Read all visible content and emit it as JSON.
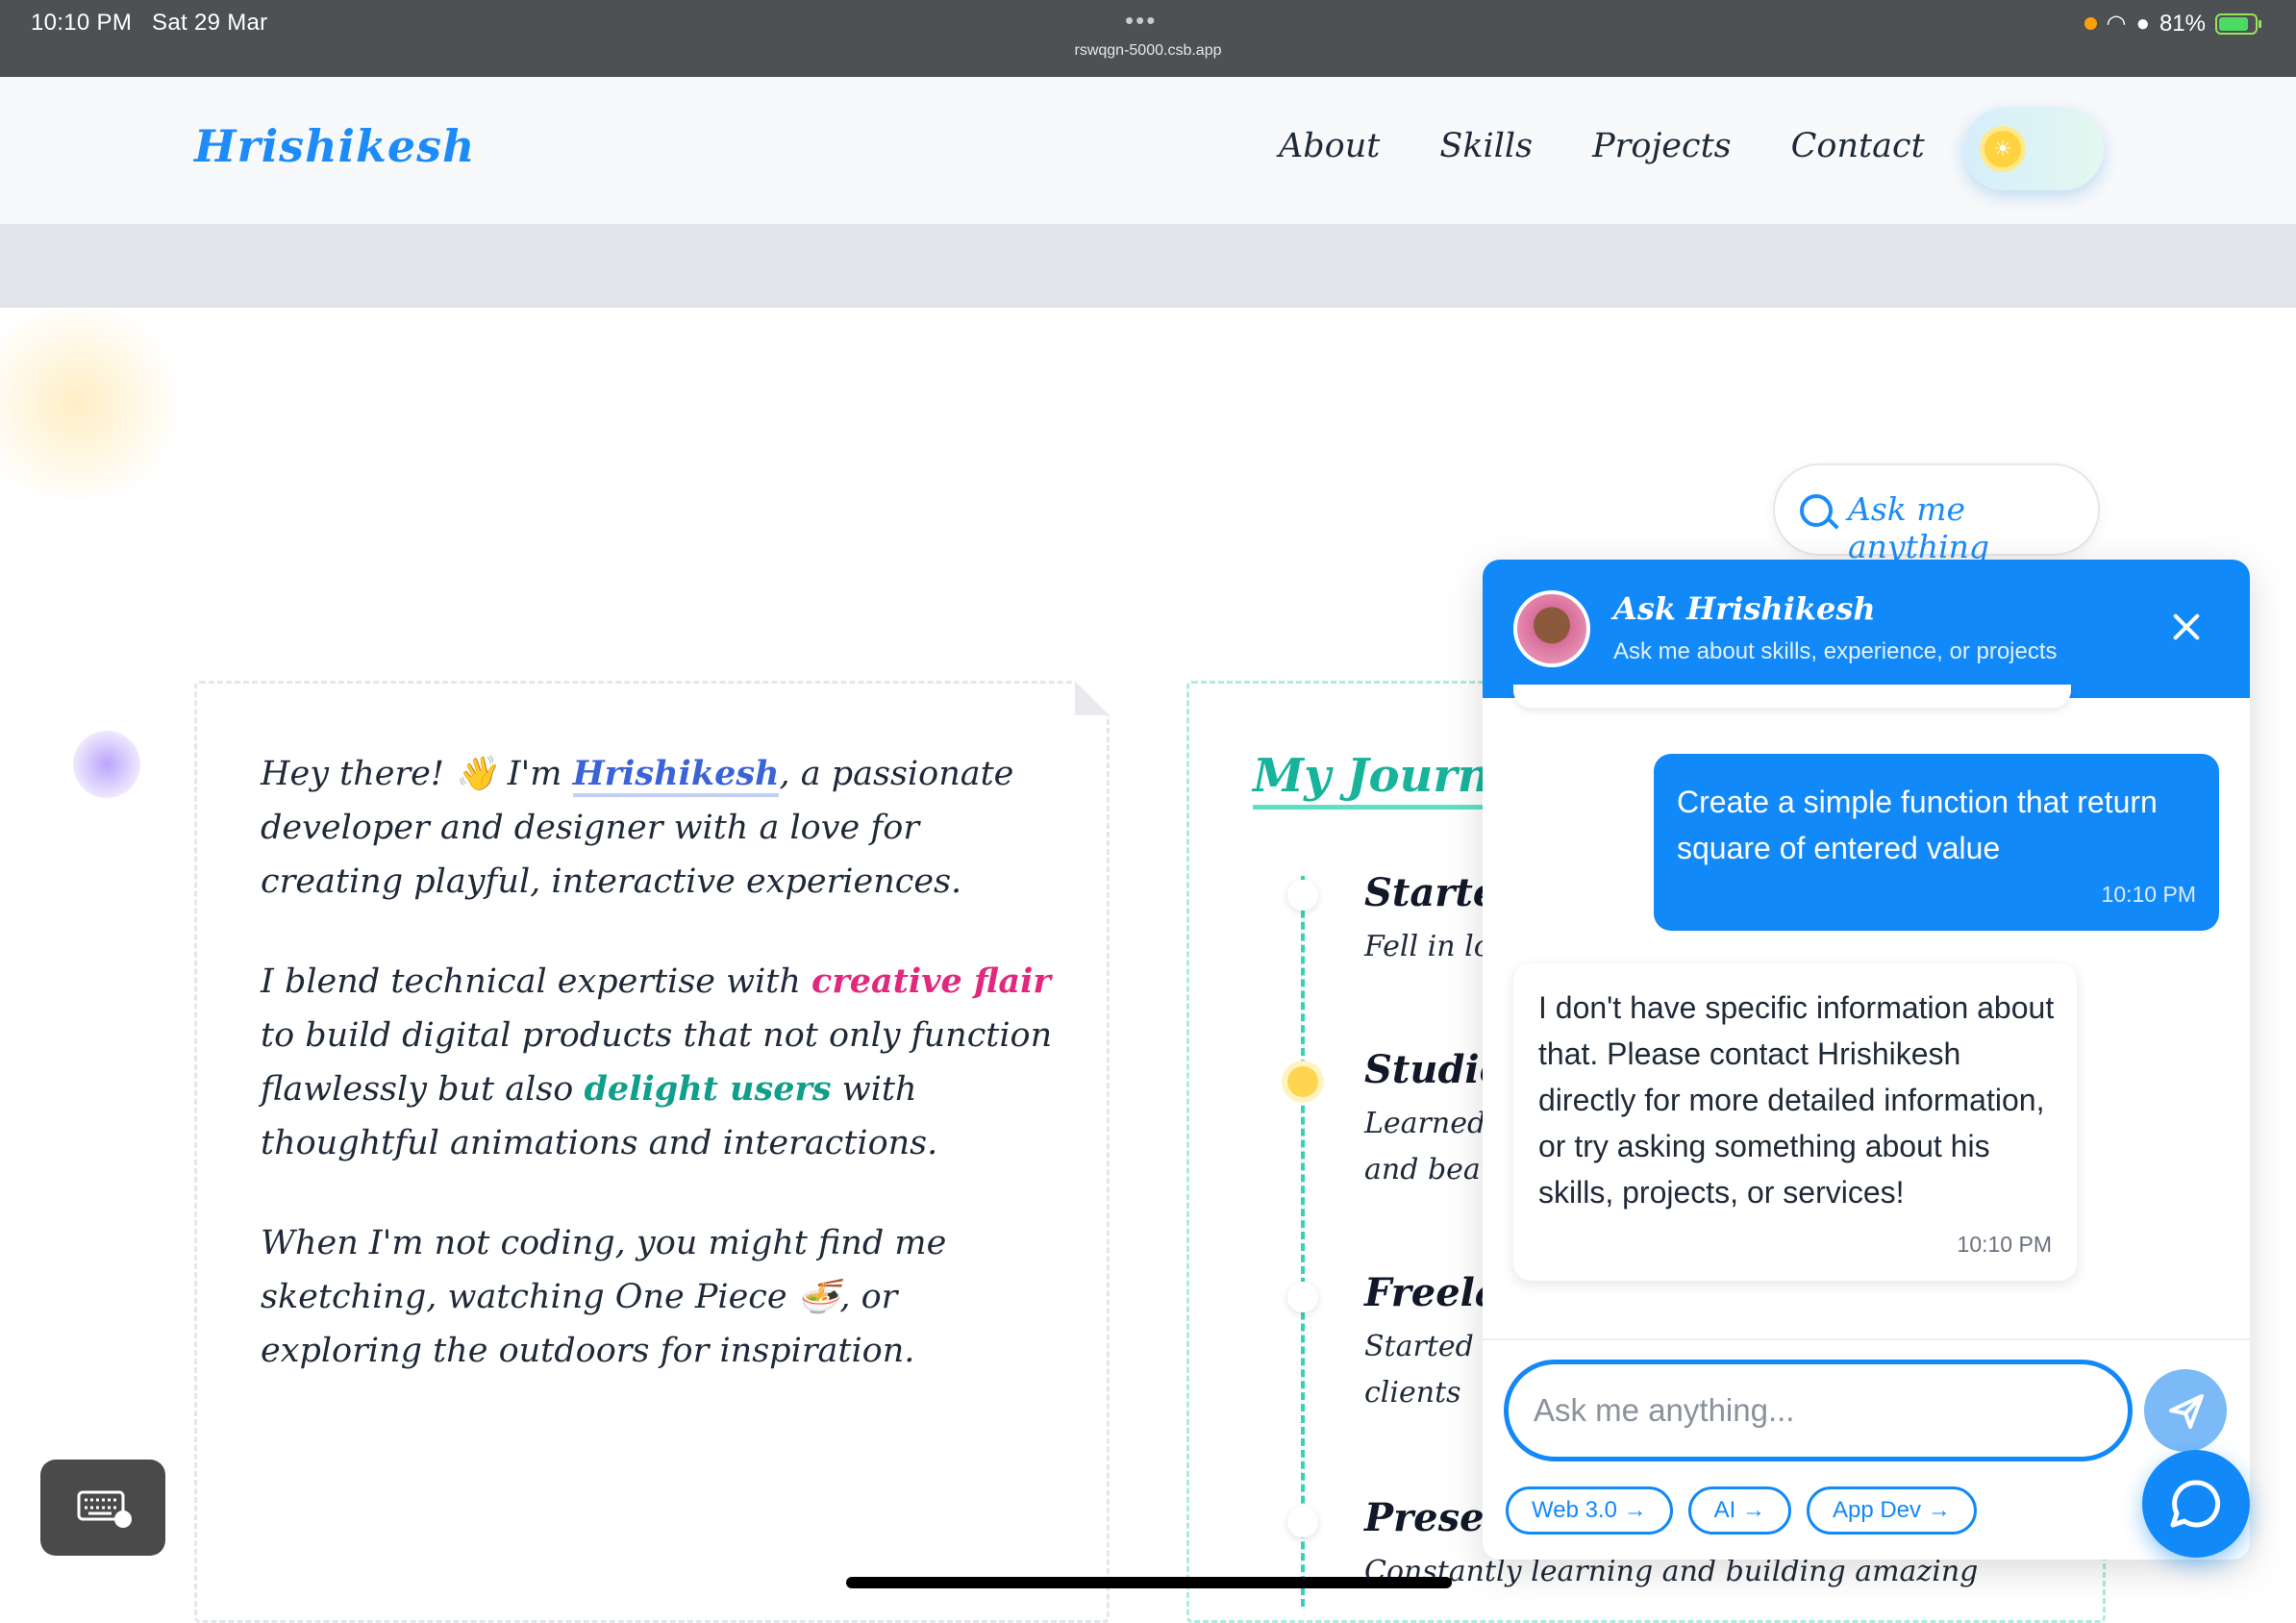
{
  "status_bar": {
    "time": "10:10 PM",
    "date": "Sat 29 Mar",
    "url": "rswqgn-5000.csb.app",
    "battery": "81%"
  },
  "navbar": {
    "logo": "Hrishikesh",
    "links": [
      "About",
      "Skills",
      "Projects",
      "Contact"
    ]
  },
  "about": {
    "p1_a": "Hey there! 👋 I'm ",
    "p1_name": "Hrishikesh",
    "p1_b": ", a passionate developer and designer with a love for creating playful, interactive experiences.",
    "p2_a": "I blend technical expertise with ",
    "p2_hl1": "creative flair",
    "p2_b": " to build digital products that not only function flawlessly but also ",
    "p2_hl2": "delight users",
    "p2_c": " with thoughtful animations and interactions.",
    "p3": "When I'm not coding, you might find me sketching, watching One Piece 🍜, or exploring the outdoors for inspiration."
  },
  "journey": {
    "title": "My Journe",
    "items": [
      {
        "title": "Starte",
        "desc": "Fell in lo"
      },
      {
        "title": "Studie",
        "desc": "Learned\nand beau"
      },
      {
        "title": "Freela",
        "desc": "Started\nclients"
      },
      {
        "title": "Prese",
        "desc": "Constantly learning and building amazing"
      }
    ]
  },
  "ask_pill": {
    "label": "Ask me anything"
  },
  "chat": {
    "title": "Ask Hrishikesh",
    "subtitle": "Ask me about skills, experience, or projects",
    "user_message": "Create a simple function that return square of entered value",
    "user_time": "10:10 PM",
    "bot_message": "I don't have specific information about that. Please contact Hrishikesh directly for more detailed information, or try asking something about his skills, projects, or services!",
    "bot_time": "10:10 PM",
    "input_placeholder": "Ask me anything...",
    "chips": [
      "Web 3.0 →",
      "AI →",
      "App Dev →"
    ]
  },
  "colors": {
    "accent": "#1289f8",
    "teal": "#17b39a",
    "pink": "#e0297d"
  }
}
